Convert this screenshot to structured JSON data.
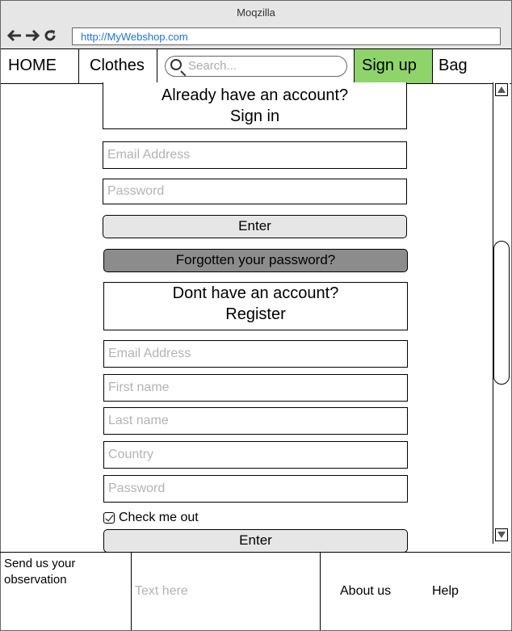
{
  "browser": {
    "title": "Moqzilla",
    "url": "http://MyWebshop.com",
    "nav_icons": [
      "back-arrow-icon",
      "forward-arrow-icon",
      "reload-icon"
    ]
  },
  "menu": {
    "home": "HOME",
    "clothes": "Clothes",
    "search_placeholder": "Search...",
    "signup": "Sign up",
    "bag": "Bag",
    "accent_color": "#8fd46a"
  },
  "signin": {
    "heading_line1": "Already have an account?",
    "heading_line2": "Sign in",
    "email_placeholder": "Email Address",
    "password_placeholder": "Password",
    "enter_label": "Enter",
    "forgot_label": "Forgotten your password?"
  },
  "register": {
    "heading_line1": "Dont have an account?",
    "heading_line2": "Register",
    "email_placeholder": "Email Address",
    "firstname_placeholder": "First name",
    "lastname_placeholder": "Last name",
    "country_placeholder": "Country",
    "password_placeholder": "Password",
    "checkbox_label": "Check me out",
    "checkbox_checked": true,
    "enter_label": "Enter"
  },
  "footer": {
    "observation_label": "Send us your observation",
    "text_placeholder": "Text here",
    "about": "About us",
    "help": "Help"
  }
}
